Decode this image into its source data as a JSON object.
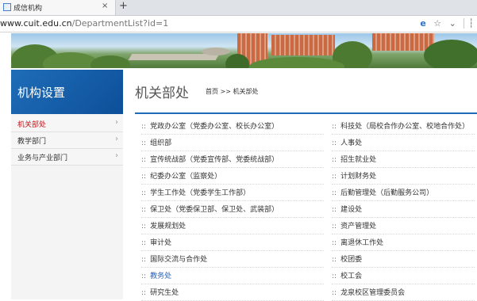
{
  "browser": {
    "tab_title": "成信机构",
    "tab_close": "×",
    "new_tab": "+",
    "url_host": "www.cuit.edu.cn",
    "url_path": "/DepartmentList?id=1",
    "icons": [
      "ie-compat-icon",
      "star-icon",
      "dropdown-icon",
      "bookmark-icon"
    ],
    "icon_glyphs": {
      "ie": "e",
      "star": "☆",
      "dropdown": "⌄",
      "bookmark": "┆"
    }
  },
  "sidebar": {
    "title": "机构设置",
    "items": [
      {
        "label": "机关部处",
        "active": true,
        "arrow": "›"
      },
      {
        "label": "教学部门",
        "active": false,
        "arrow": "›"
      },
      {
        "label": "业务与产业部门",
        "active": false,
        "arrow": "›"
      }
    ]
  },
  "main": {
    "title": "机关部处",
    "breadcrumb": {
      "home": "首页",
      "sep": ">>",
      "current": "机关部处"
    },
    "bullet": "::",
    "left_column": [
      {
        "name": "党政办公室（党委办公室、校长办公室）",
        "highlight": false
      },
      {
        "name": "组织部",
        "highlight": false
      },
      {
        "name": "宣传统战部（党委宣传部、党委统战部）",
        "highlight": false
      },
      {
        "name": "纪委办公室（监察处）",
        "highlight": false
      },
      {
        "name": "学生工作处（党委学生工作部）",
        "highlight": false
      },
      {
        "name": "保卫处（党委保卫部、保卫处、武装部）",
        "highlight": false
      },
      {
        "name": "发展规划处",
        "highlight": false
      },
      {
        "name": "审计处",
        "highlight": false
      },
      {
        "name": "国际交流与合作处",
        "highlight": false
      },
      {
        "name": "教务处",
        "highlight": true
      },
      {
        "name": "研究生处",
        "highlight": false
      }
    ],
    "right_column": [
      {
        "name": "科技处（局校合作办公室、校地合作处）"
      },
      {
        "name": "人事处"
      },
      {
        "name": "招生就业处"
      },
      {
        "name": "计划财务处"
      },
      {
        "name": "后勤管理处（后勤服务公司）"
      },
      {
        "name": "建设处"
      },
      {
        "name": "资产管理处"
      },
      {
        "name": "离退休工作处"
      },
      {
        "name": "校团委"
      },
      {
        "name": "校工会"
      },
      {
        "name": "龙泉校区管理委员会"
      }
    ]
  },
  "colors": {
    "accent": "#1f6db8",
    "active": "#c4161c",
    "link_highlight": "#2a64b8"
  }
}
